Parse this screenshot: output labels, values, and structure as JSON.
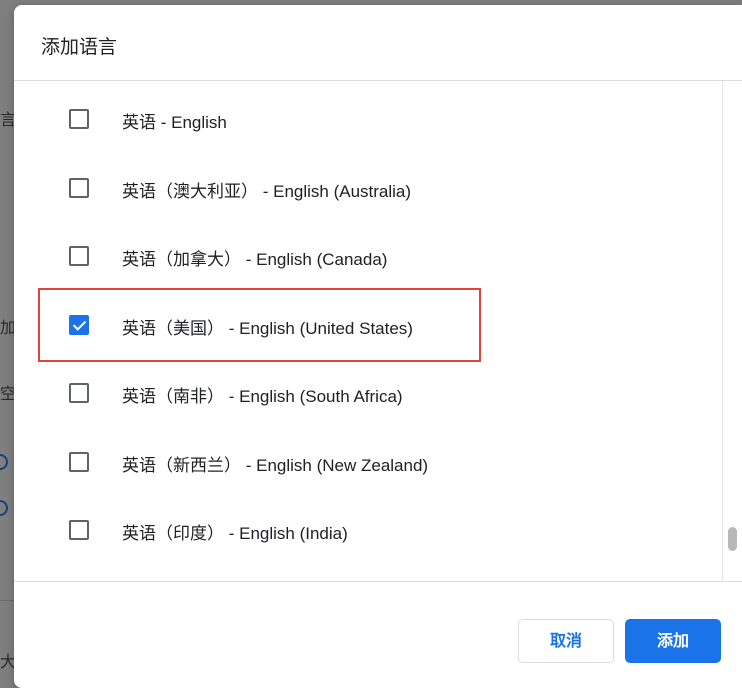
{
  "dialog": {
    "title": "添加语言"
  },
  "background": {
    "glyphs": [
      "言",
      "加",
      "空",
      "大"
    ]
  },
  "languages": [
    {
      "label": "英语 - English",
      "checked": false
    },
    {
      "label": "英语（澳大利亚） - English (Australia)",
      "checked": false
    },
    {
      "label": "英语（加拿大） - English (Canada)",
      "checked": false
    },
    {
      "label": "英语（美国） - English (United States)",
      "checked": true
    },
    {
      "label": "英语（南非） - English (South Africa)",
      "checked": false
    },
    {
      "label": "英语（新西兰） - English (New Zealand)",
      "checked": false
    },
    {
      "label": "英语（印度） - English (India)",
      "checked": false
    }
  ],
  "buttons": {
    "cancel": "取消",
    "add": "添加"
  },
  "colors": {
    "accent": "#1a73e8",
    "highlight": "#e0423c"
  }
}
